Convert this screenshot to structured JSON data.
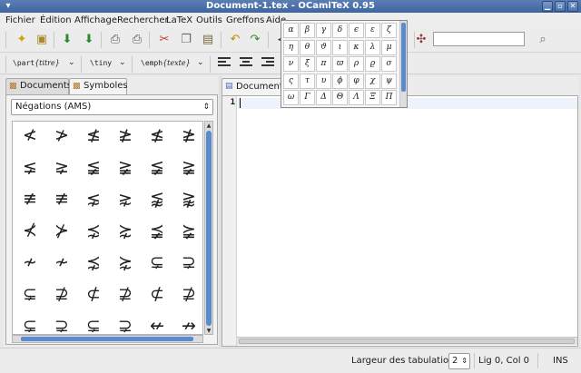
{
  "window": {
    "title": "Document-1.tex - OCamlTeX 0.95",
    "controls": [
      "minimize-icon",
      "maximize-icon",
      "close-icon"
    ]
  },
  "menu": [
    "Fichier",
    "Édition",
    "Affichage",
    "Rechercher",
    "LaTeX",
    "Outils",
    "Greffons",
    "Aide"
  ],
  "toolbar2": {
    "part_cmd": "\\part",
    "part_arg": "{titre}",
    "tiny_cmd": "\\tiny",
    "emph_cmd": "\\emph",
    "emph_arg": "{texte}",
    "dropdown_arrow": "⌄"
  },
  "greek_popup": {
    "rows": [
      [
        "α",
        "β",
        "γ",
        "δ",
        "ϵ",
        "ε",
        "ζ"
      ],
      [
        "η",
        "θ",
        "ϑ",
        "ι",
        "κ",
        "λ",
        "μ"
      ],
      [
        "ν",
        "ξ",
        "π",
        "ϖ",
        "ρ",
        "ϱ",
        "σ"
      ],
      [
        "ς",
        "τ",
        "υ",
        "ϕ",
        "φ",
        "χ",
        "ψ"
      ],
      [
        "ω",
        "Γ",
        "Δ",
        "Θ",
        "Λ",
        "Ξ",
        "Π"
      ]
    ]
  },
  "left_panel": {
    "tabs": [
      {
        "label": "Documents",
        "icon": "documents-icon"
      },
      {
        "label": "Symboles",
        "icon": "symbols-icon"
      }
    ],
    "category_select": "Négations (AMS)",
    "symbols": [
      [
        "≮",
        "≯",
        "≰",
        "≱",
        "≰",
        "≱"
      ],
      [
        "⪇",
        "⪈",
        "≨",
        "≩",
        "≨",
        "≩"
      ],
      [
        "≢",
        "≢",
        "⋦",
        "⋧",
        "⪉",
        "⪊"
      ],
      [
        "⊀",
        "⊁",
        "⋨",
        "⋩",
        "⪵",
        "⪶"
      ],
      [
        "≁",
        "≁",
        "⋨",
        "⋩",
        "⊊",
        "⊋"
      ],
      [
        "⊊",
        "⊉",
        "⊄",
        "⊉",
        "⊄",
        "⊉"
      ],
      [
        "⊊",
        "⊋",
        "⊊",
        "⊋",
        "↚",
        "↛"
      ]
    ]
  },
  "editor": {
    "tab_label": "Document-1",
    "tab_icon": "tex-document-icon",
    "line_numbers": [
      "1"
    ]
  },
  "status": {
    "tab_width_label": "Largeur des tabulations :",
    "tab_width_value": "2",
    "cursor_pos": "Lig 0, Col 0",
    "mode": "INS"
  }
}
